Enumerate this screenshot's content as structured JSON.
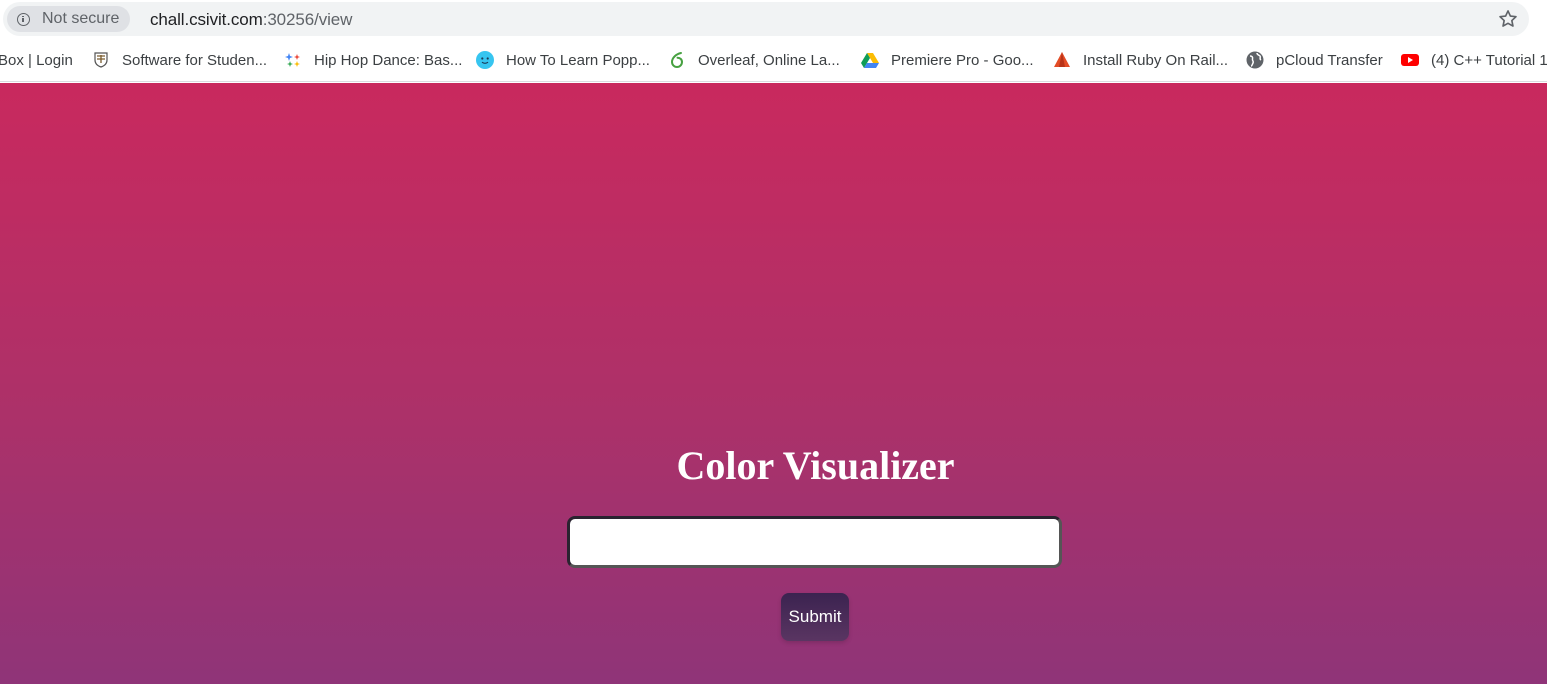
{
  "browser": {
    "security_label": "Not secure",
    "url_host": "chall.csivit.com",
    "url_rest": ":30256/view",
    "info_icon": "info-icon",
    "star_icon": "star-icon"
  },
  "bookmarks": [
    {
      "label": "Box | Login",
      "icon": "none"
    },
    {
      "label": "Software for Studen...",
      "icon": "crest-icon"
    },
    {
      "label": "Hip Hop Dance: Bas...",
      "icon": "sparkle-icon"
    },
    {
      "label": "How To Learn Popp...",
      "icon": "smiley-icon"
    },
    {
      "label": "Overleaf, Online La...",
      "icon": "overleaf-icon"
    },
    {
      "label": "Premiere Pro - Goo...",
      "icon": "google-drive-icon"
    },
    {
      "label": "Install Ruby On Rail...",
      "icon": "ruby-icon"
    },
    {
      "label": "pCloud Transfer",
      "icon": "globe-icon"
    },
    {
      "label": "(4) C++ Tutorial 1",
      "icon": "youtube-icon"
    }
  ],
  "main": {
    "title": "Color Visualizer",
    "input_value": "",
    "submit_label": "Submit"
  },
  "colors": {
    "gradient_top": "#c9295e",
    "gradient_bottom": "#8f3478",
    "button": "#4a2b5a"
  }
}
